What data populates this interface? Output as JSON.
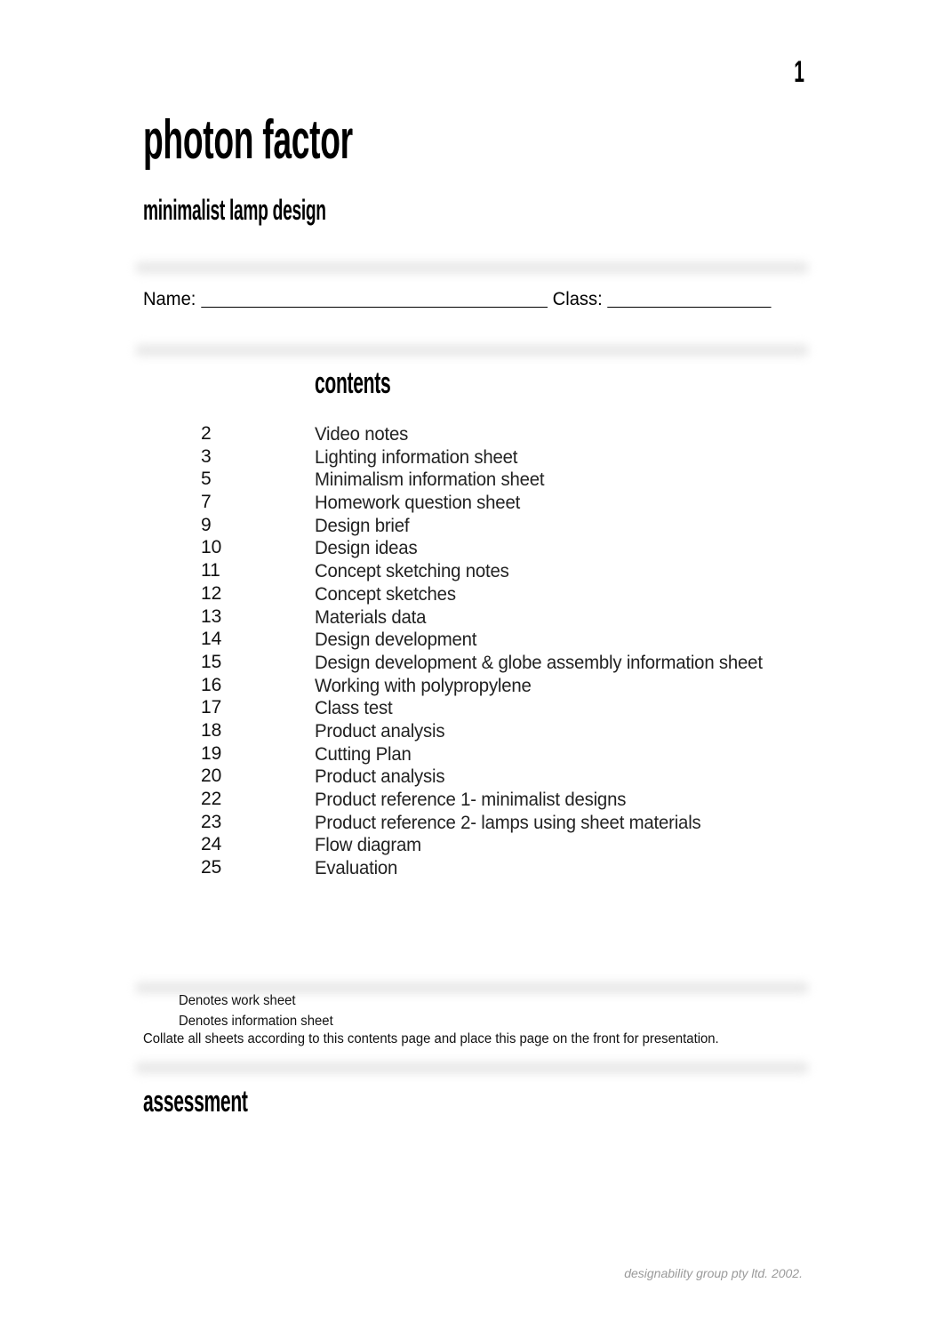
{
  "document": {
    "page_number": "1",
    "title": "photon factor",
    "subtitle": "minimalist lamp design"
  },
  "student_fields": {
    "name_label": "Name:",
    "name_value": "",
    "class_label": "Class:",
    "class_value": ""
  },
  "contents": {
    "heading": "contents",
    "items": [
      {
        "page": "2",
        "label": "Video notes"
      },
      {
        "page": "3",
        "label": "Lighting information sheet"
      },
      {
        "page": "5",
        "label": "Minimalism information sheet"
      },
      {
        "page": "7",
        "label": "Homework question sheet"
      },
      {
        "page": "9",
        "label": "Design brief"
      },
      {
        "page": "10",
        "label": "Design ideas"
      },
      {
        "page": "11",
        "label": "Concept sketching notes"
      },
      {
        "page": "12",
        "label": "Concept sketches"
      },
      {
        "page": "13",
        "label": "Materials data"
      },
      {
        "page": "14",
        "label": "Design development"
      },
      {
        "page": "15",
        "label": "Design development & globe assembly information sheet"
      },
      {
        "page": "16",
        "label": "Working with polypropylene"
      },
      {
        "page": "17",
        "label": "Class test"
      },
      {
        "page": "18",
        "label": "Product analysis"
      },
      {
        "page": "19",
        "label": "Cutting Plan"
      },
      {
        "page": "20",
        "label": "Product analysis"
      },
      {
        "page": "22",
        "label": "Product reference  1- minimalist designs"
      },
      {
        "page": "23",
        "label": "Product reference  2- lamps using sheet materials"
      },
      {
        "page": "24",
        "label": "Flow diagram"
      },
      {
        "page": "25",
        "label": "Evaluation"
      }
    ]
  },
  "legend": {
    "work_sheet": "Denotes work sheet",
    "information_sheet": "Denotes information sheet",
    "collate_note": "Collate all sheets according to this contents page and place this page on the front for presentation."
  },
  "assessment": {
    "heading": "assessment"
  },
  "footer": {
    "credit": "designability group pty ltd. 2002."
  },
  "colors": {
    "text": "#000000",
    "divider": "#e9e9e9",
    "footer_text": "#9a9a9a"
  }
}
